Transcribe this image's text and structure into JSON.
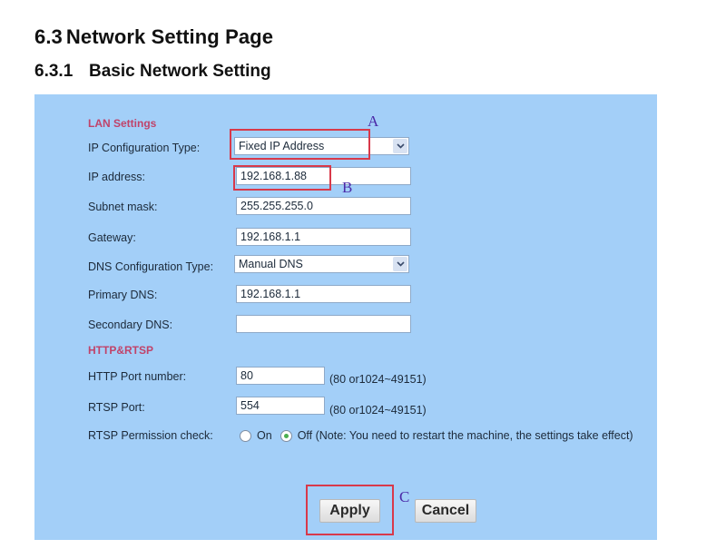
{
  "document": {
    "heading1_number": "6.3",
    "heading1_text": "Network Setting Page",
    "heading2_number": "6.3.1",
    "heading2_text": "Basic Network Setting"
  },
  "lan_settings": {
    "section_title": "LAN Settings",
    "ip_config_type": {
      "label": "IP Configuration Type:",
      "value": "Fixed IP Address"
    },
    "ip_address": {
      "label": "IP address:",
      "value": "192.168.1.88"
    },
    "subnet_mask": {
      "label": "Subnet mask:",
      "value": "255.255.255.0"
    },
    "gateway": {
      "label": "Gateway:",
      "value": "192.168.1.1"
    },
    "dns_config_type": {
      "label": "DNS Configuration Type:",
      "value": "Manual DNS"
    },
    "primary_dns": {
      "label": "Primary DNS:",
      "value": "192.168.1.1"
    },
    "secondary_dns": {
      "label": "Secondary DNS:",
      "value": ""
    }
  },
  "http_rtsp": {
    "section_title": "HTTP&RTSP",
    "http_port": {
      "label": "HTTP Port number:",
      "value": "80",
      "hint": "(80 or1024~49151)"
    },
    "rtsp_port": {
      "label": "RTSP Port:",
      "value": "554",
      "hint": "(80 or1024~49151)"
    },
    "rtsp_permission": {
      "label": "RTSP Permission check:",
      "on_label": "On",
      "off_label": "Off (Note: You need to restart the machine, the settings take effect)",
      "selected": "Off"
    }
  },
  "buttons": {
    "apply": "Apply",
    "cancel": "Cancel"
  },
  "annotations": {
    "a": "A",
    "b": "B",
    "c": "C"
  },
  "colors": {
    "panel_bg": "#a3cff8",
    "section_title": "#c0436a",
    "annotation_box": "#d8394a",
    "annotation_letter": "#4b2aa8"
  }
}
